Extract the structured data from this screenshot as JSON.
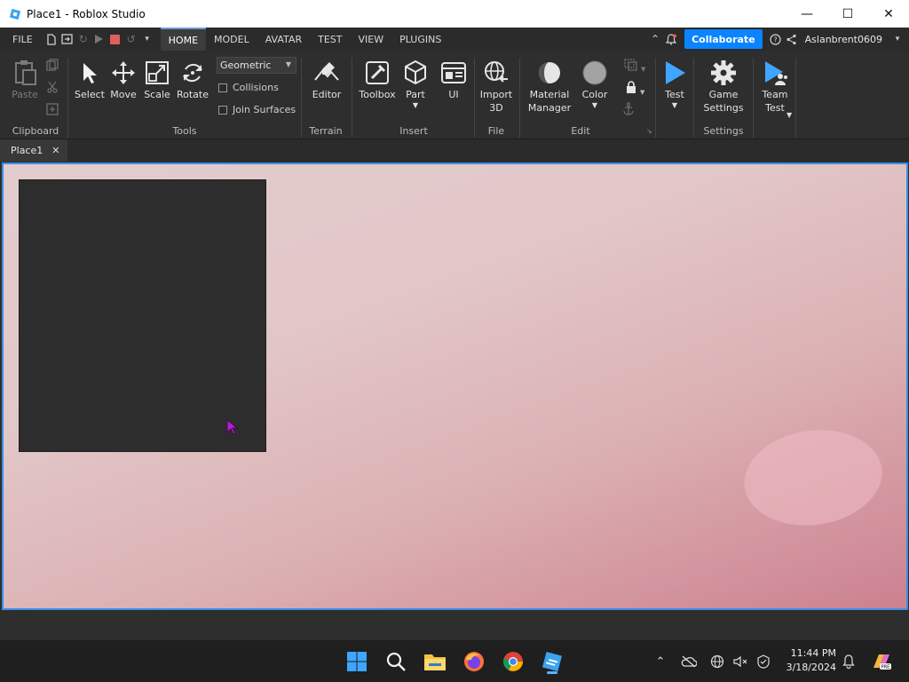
{
  "window": {
    "title": "Place1 - Roblox Studio",
    "minimize": "—",
    "maximize": "☐",
    "close": "✕"
  },
  "menu": {
    "file": "FILE",
    "tabs": [
      "HOME",
      "MODEL",
      "AVATAR",
      "TEST",
      "VIEW",
      "PLUGINS"
    ],
    "active_tab": "HOME",
    "collaborate": "Collaborate",
    "username": "Aslanbrent0609"
  },
  "ribbon": {
    "clipboard": {
      "paste": "Paste",
      "label": "Clipboard"
    },
    "tools": {
      "select": "Select",
      "move": "Move",
      "scale": "Scale",
      "rotate": "Rotate",
      "mode": "Geometric",
      "collisions": "Collisions",
      "join_surfaces": "Join Surfaces",
      "label": "Tools"
    },
    "terrain": {
      "editor": "Editor",
      "label": "Terrain"
    },
    "insert": {
      "toolbox": "Toolbox",
      "part": "Part",
      "ui": "UI",
      "label": "Insert"
    },
    "file": {
      "import_line1": "Import",
      "import_line2": "3D",
      "label": "File"
    },
    "edit": {
      "material_line1": "Material",
      "material_line2": "Manager",
      "color": "Color",
      "label": "Edit"
    },
    "test": {
      "test": "Test"
    },
    "settings": {
      "game_line1": "Game",
      "game_line2": "Settings",
      "label": "Settings"
    },
    "team": {
      "line1": "Team",
      "line2": "Test"
    }
  },
  "document": {
    "tab": "Place1",
    "close": "✕"
  },
  "taskbar": {
    "time": "11:44 PM",
    "date": "3/18/2024"
  },
  "colors": {
    "accent": "#0a84ff",
    "viewport_border": "#3a8ee6",
    "stop": "#e35d5d",
    "test_play": "#3ea6ff"
  }
}
